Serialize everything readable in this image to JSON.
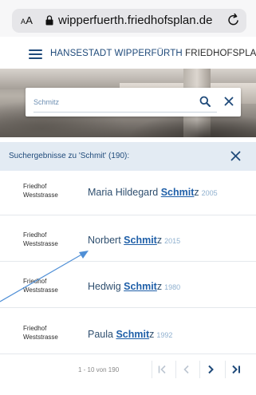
{
  "browser": {
    "aa_label_big": "A",
    "aa_label_small": "A",
    "domain": "wipperfuerth.friedhofsplan.de"
  },
  "header": {
    "brand_main": "HANSESTADT WIPPERFÜRTH",
    "brand_sub": " FRIEDHOFSPLAN"
  },
  "search": {
    "value": "Schmitz"
  },
  "results": {
    "heading": "Suchergebnisse zu 'Schmit' (190):",
    "items": [
      {
        "cemetery_line1": "Friedhof",
        "cemetery_line2": "Weststrasse",
        "first": "Maria Hildegard ",
        "hl": "Schmit",
        "rest": "z",
        "year": "2005"
      },
      {
        "cemetery_line1": "Friedhof",
        "cemetery_line2": "Weststrasse",
        "first": "Norbert ",
        "hl": "Schmit",
        "rest": "z",
        "year": "2015"
      },
      {
        "cemetery_line1": "Friedhof",
        "cemetery_line2": "Weststrasse",
        "first": "Hedwig ",
        "hl": "Schmit",
        "rest": "z",
        "year": "1980"
      },
      {
        "cemetery_line1": "Friedhof",
        "cemetery_line2": "Weststrasse",
        "first": "Paula ",
        "hl": "Schmit",
        "rest": "z",
        "year": "1992"
      }
    ]
  },
  "pager": {
    "count": "1 - 10 von 190"
  },
  "colors": {
    "accent": "#1f4a7a",
    "link": "#1f5fa8",
    "results_bg": "#e3ebf3"
  }
}
